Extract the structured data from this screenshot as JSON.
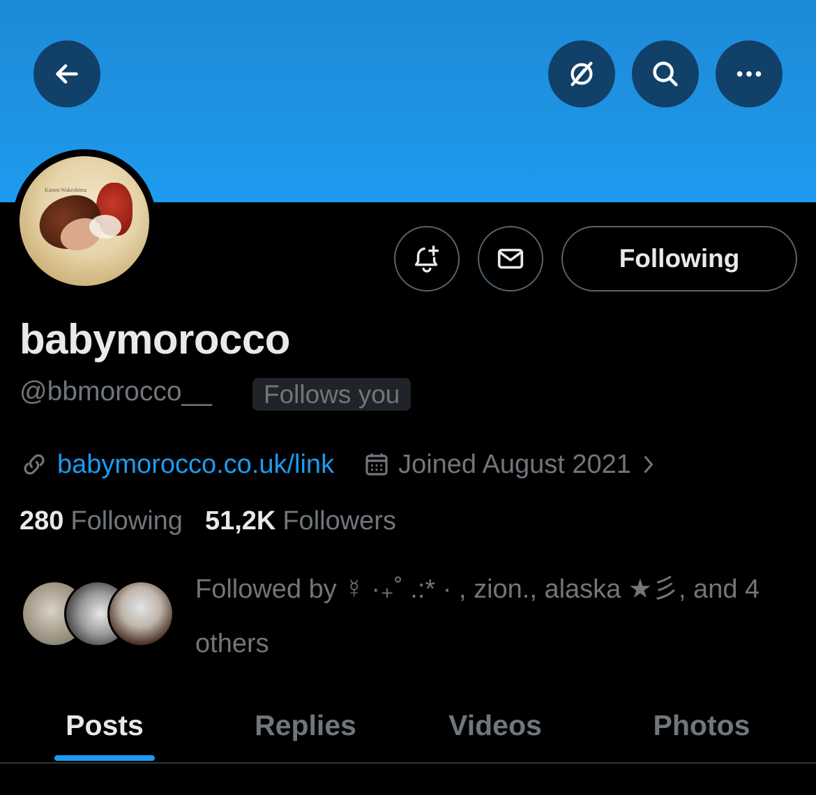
{
  "header": {
    "back_icon": "arrow-left-icon",
    "grok_icon": "slashed-circle-icon",
    "search_icon": "search-icon",
    "more_icon": "more-dots-icon",
    "banner_color": "#1d9bf0"
  },
  "profile": {
    "avatar_cover_text": "Kanon Wakeshima",
    "display_name": "babymorocco",
    "handle": "@bbmorocco__",
    "follows_you_badge": "Follows you",
    "website": "babymorocco.co.uk/link",
    "joined": "Joined August 2021"
  },
  "actions": {
    "notify_icon": "bell-plus-icon",
    "message_icon": "envelope-icon",
    "following_label": "Following"
  },
  "stats": {
    "following_count": "280",
    "following_label": "Following",
    "followers_count": "51,2K",
    "followers_label": "Followers"
  },
  "followed_by": {
    "text": "Followed by ☿ ·₊˚ .:* · , zion., alaska ★彡, and 4 others"
  },
  "tabs": [
    {
      "label": "Posts",
      "active": true
    },
    {
      "label": "Replies",
      "active": false
    },
    {
      "label": "Videos",
      "active": false
    },
    {
      "label": "Photos",
      "active": false
    }
  ],
  "colors": {
    "accent": "#1d9bf0",
    "muted_text": "#71767b",
    "primary_text": "#e7e9ea",
    "background": "#000000"
  }
}
